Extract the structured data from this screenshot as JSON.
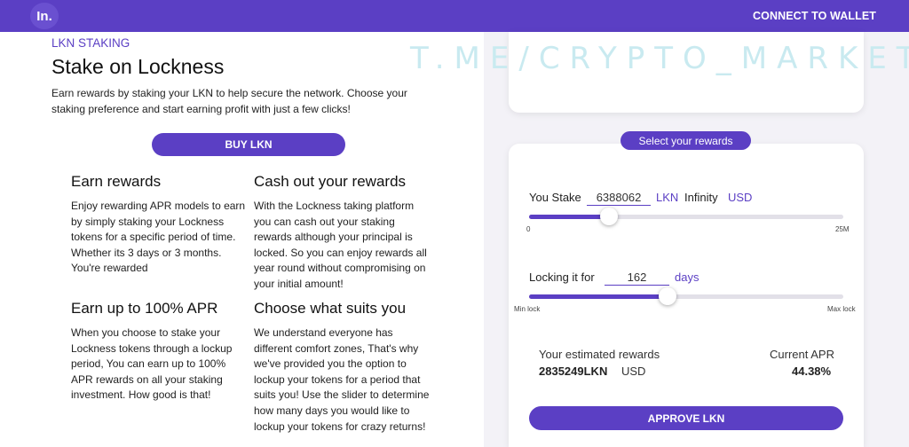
{
  "header": {
    "logo_text": "In.",
    "connect_label": "CONNECT TO WALLET"
  },
  "watermark": "T.ME/CRYPTO_MARKET",
  "hero": {
    "eyebrow": "LKN STAKING",
    "title": "Stake on Lockness",
    "intro": "Earn rewards by staking your LKN to help secure the network. Choose your staking preference and start earning profit with just a few clicks!",
    "buy_label": "BUY LKN"
  },
  "features": [
    {
      "title": "Earn rewards",
      "body": "Enjoy rewarding APR models to earn by simply staking your Lockness tokens for a specific period of time. Whether its 3 days or 3 months. You're rewarded"
    },
    {
      "title": "Cash out your rewards",
      "body": "With the Lockness taking platform you can cash out your staking rewards although your principal is locked. So you can enjoy rewards all year round without compromising on your initial amount!"
    },
    {
      "title": "Earn up to 100% APR",
      "body": "When you choose to stake your Lockness tokens through a lockup period, You can earn up to 100% APR rewards on all your staking investment. How good is that!"
    },
    {
      "title": "Choose what suits you",
      "body": "We understand everyone has different comfort zones, That's why we've provided you the option to lockup your tokens for a period that suits you! Use the slider to determine how many days you would like to lockup your tokens for crazy returns!"
    }
  ],
  "rewards_panel": {
    "select_label": "Select your rewards",
    "stake": {
      "label": "You Stake",
      "value": "6388062",
      "token": "LKN",
      "usd_value": "Infinity",
      "usd_label": "USD",
      "slider_fraction": 0.255,
      "min_label": "0",
      "max_label": "25M"
    },
    "lock": {
      "label": "Locking it for",
      "value": "162",
      "unit": "days",
      "slider_fraction": 0.44,
      "min_label": "Min lock",
      "max_label": "Max lock"
    },
    "estimate": {
      "label": "Your estimated rewards",
      "value": "2835249LKN",
      "usd_label": "USD",
      "apr_label": "Current APR",
      "apr_value": "44.38%"
    },
    "approve_label": "APPROVE LKN"
  },
  "colors": {
    "brand": "#5b3fc4",
    "panel_bg": "#f3f2f7"
  }
}
